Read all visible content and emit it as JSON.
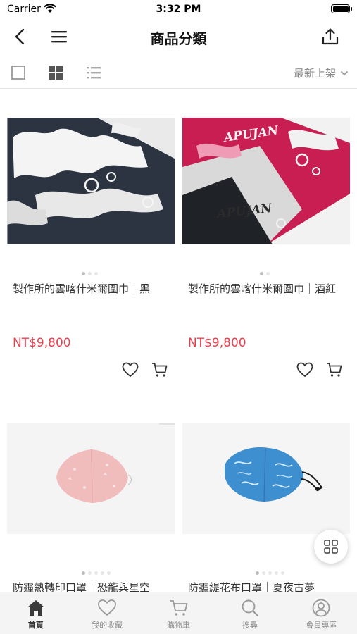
{
  "status_bar": {
    "carrier": "Carrier",
    "time": "3:32 PM"
  },
  "nav": {
    "title": "商品分類",
    "back_icon": "chevron-left-icon",
    "menu_icon": "hamburger-menu-icon",
    "share_icon": "share-icon"
  },
  "view_options": {
    "modes": [
      "single-column-icon",
      "grid-icon",
      "list-icon"
    ],
    "active_mode": "grid",
    "sort_label": "最新上架"
  },
  "products": [
    {
      "name": "製作所的雲喀什米爾圍巾｜黑",
      "price": "NT$9,800",
      "image_pages": 3,
      "current_page": 1
    },
    {
      "name": "製作所的雲喀什米爾圍巾｜酒紅",
      "price": "NT$9,800",
      "image_pages": 2,
      "current_page": 1,
      "print_text": "APUJAN"
    },
    {
      "name": "防霾熱轉印口罩｜恐龍與星空",
      "image_pages": 5,
      "current_page": 1
    },
    {
      "name": "防霾緹花布口罩｜夏夜古夢",
      "image_pages": 5,
      "current_page": 1
    }
  ],
  "tab_bar": {
    "active": "home",
    "tabs": [
      {
        "id": "home",
        "label": "首頁",
        "icon": "home-icon"
      },
      {
        "id": "favorites",
        "label": "我的收藏",
        "icon": "heart-icon"
      },
      {
        "id": "cart",
        "label": "購物車",
        "icon": "cart-icon"
      },
      {
        "id": "search",
        "label": "搜尋",
        "icon": "search-icon"
      },
      {
        "id": "member",
        "label": "會員專區",
        "icon": "user-icon"
      }
    ]
  },
  "colors": {
    "price": "#e8404e",
    "scarf_black": "#2b3440",
    "scarf_red": "#c81e52",
    "mask_pink": "#f1bcbc",
    "mask_blue": "#3e8fd0"
  }
}
